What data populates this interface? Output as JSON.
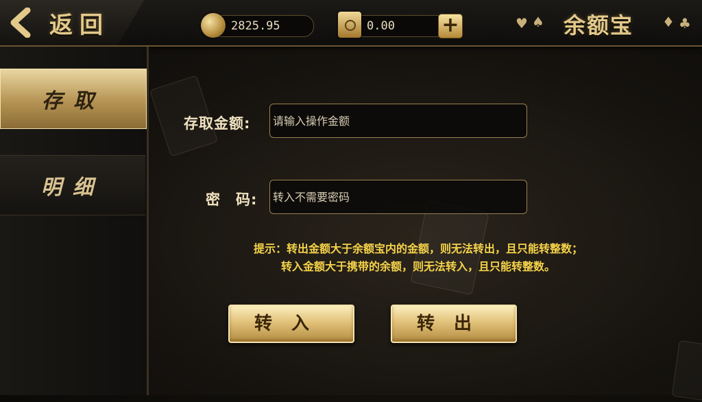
{
  "header": {
    "back_label": "返回",
    "balance": "2825.95",
    "safe_balance": "0.00",
    "add_symbol": "+",
    "title": "余额宝",
    "suits": [
      "♥",
      "♠",
      "♦",
      "♣"
    ]
  },
  "sidebar": {
    "items": [
      {
        "label": "存取",
        "active": true
      },
      {
        "label": "明细",
        "active": false
      }
    ]
  },
  "form": {
    "amount_label": "存取金额:",
    "amount_placeholder": "请输入操作金额",
    "amount_value": "",
    "password_label": "密　码:",
    "password_placeholder": "转入不需要密码",
    "password_value": ""
  },
  "hint": {
    "line1": "提示：转出金额大于余额宝内的金额，则无法转出，且只能转整数；",
    "line2": "转入金额大于携带的余额，则无法转入，且只能转整数。"
  },
  "buttons": {
    "deposit": "转入",
    "withdraw": "转出"
  },
  "colors": {
    "gold": "#e3c98a",
    "hint_yellow": "#f6d34a",
    "background": "#15120e"
  }
}
